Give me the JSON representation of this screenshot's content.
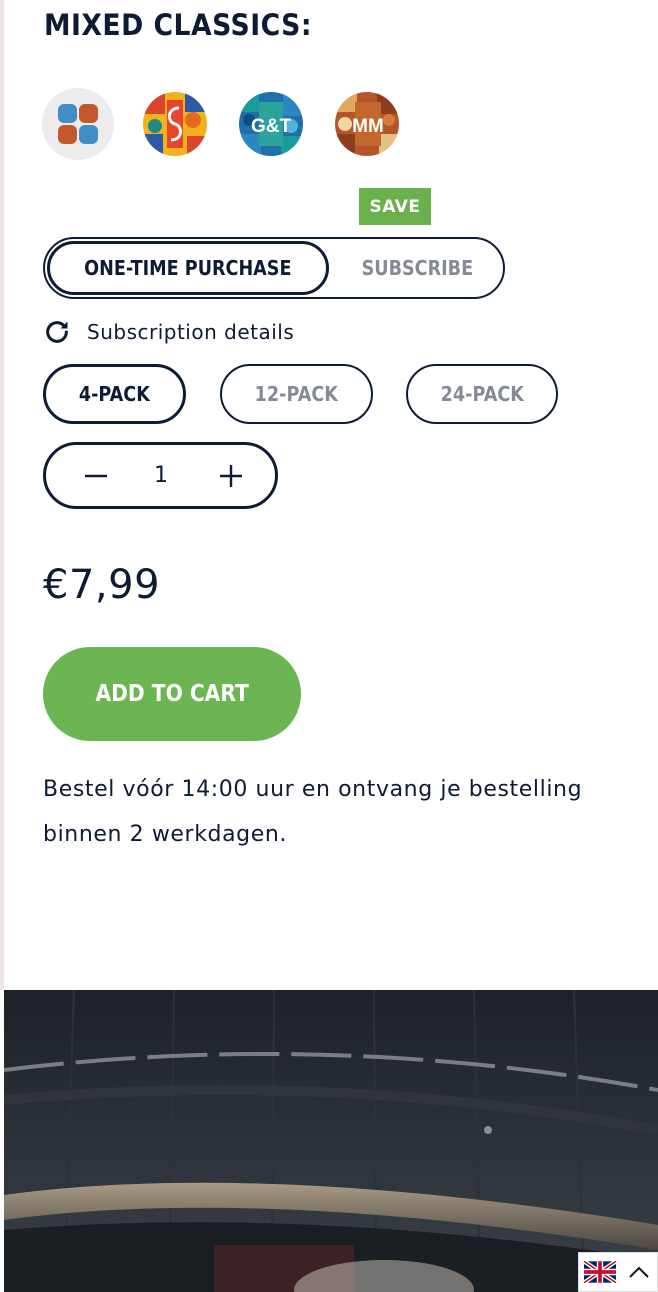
{
  "product": {
    "variant_heading": "MIXED CLASSICS:",
    "variants": [
      {
        "icon": "mixed-classics-swatch-icon",
        "selected": true
      },
      {
        "icon": "s-swatch-icon",
        "label": "S"
      },
      {
        "icon": "gt-swatch-icon",
        "label": "G&T"
      },
      {
        "icon": "mm-swatch-icon",
        "label": "MM"
      }
    ]
  },
  "purchase": {
    "save_badge": "SAVE",
    "one_time_label": "ONE-TIME PURCHASE",
    "subscribe_label": "SUBSCRIBE",
    "subscription_details": "Subscription details"
  },
  "packs": {
    "items": [
      {
        "label": "4-PACK",
        "selected": true
      },
      {
        "label": "12-PACK"
      },
      {
        "label": "24-PACK"
      }
    ]
  },
  "quantity": {
    "value": "1"
  },
  "price": "€7,99",
  "cart": {
    "add_label": "ADD TO CART"
  },
  "delivery_note": "Bestel vóór 14:00 uur en ontvang je bestelling binnen 2 werkdagen.",
  "language": {
    "current_flag": "uk-flag-icon",
    "toggle_icon": "chevron-up-icon"
  },
  "colors": {
    "navy": "#0d1b33",
    "green": "#6bb653",
    "grey_text": "#858b96"
  }
}
